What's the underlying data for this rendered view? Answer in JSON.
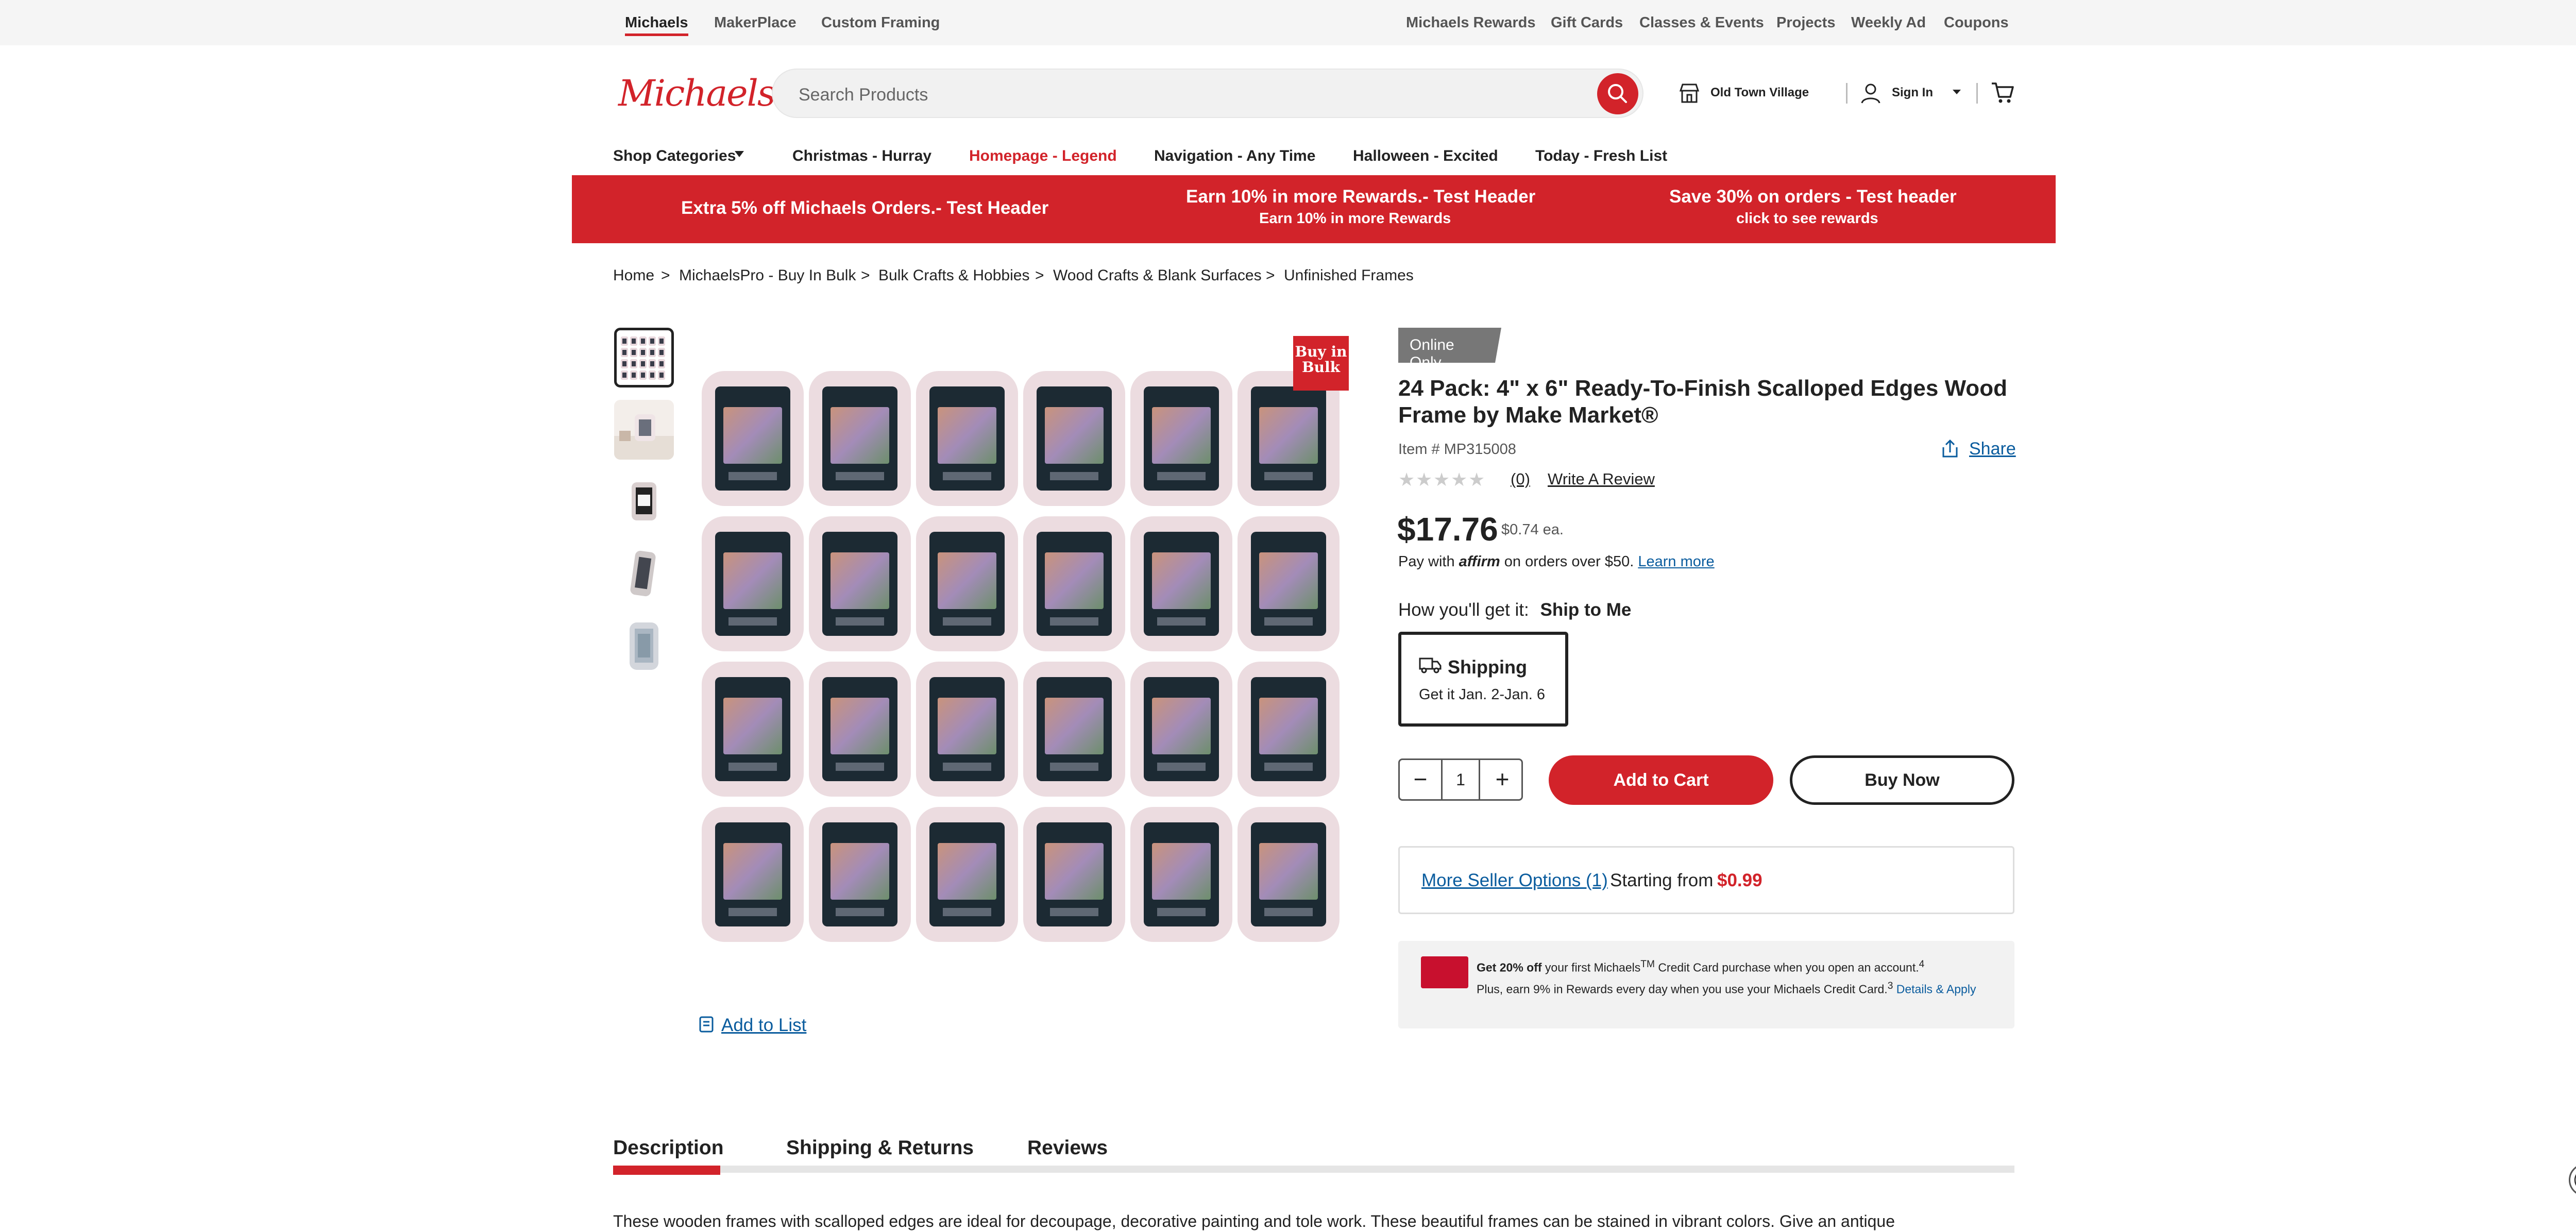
{
  "utility_nav": {
    "left": [
      "Michaels",
      "MakerPlace",
      "Custom Framing"
    ],
    "right": [
      "Michaels Rewards",
      "Gift Cards",
      "Classes & Events",
      "Projects",
      "Weekly Ad",
      "Coupons"
    ]
  },
  "header": {
    "logo": "Michaels",
    "search_placeholder": "Search Products",
    "store": "Old Town Village",
    "sign_in": "Sign In"
  },
  "main_nav": [
    "Shop Categories",
    "Christmas - Hurray",
    "Homepage - Legend",
    "Navigation - Any Time",
    "Halloween - Excited",
    "Today - Fresh List"
  ],
  "promo": [
    {
      "title": "Extra 5% off Michaels Orders.- Test Header",
      "sub": ""
    },
    {
      "title": "Earn 10% in more Rewards.- Test Header",
      "sub": "Earn 10% in more Rewards"
    },
    {
      "title": "Save 30% on orders - Test header",
      "sub": "click to see rewards"
    }
  ],
  "breadcrumb": [
    "Home",
    "MichaelsPro - Buy In Bulk",
    "Bulk Crafts & Hobbies",
    "Wood Crafts & Blank Surfaces",
    "Unfinished Frames"
  ],
  "badge_bulk": "Buy in Bulk",
  "product": {
    "badge": "Online Only",
    "title": "24 Pack: 4\" x 6\" Ready-To-Finish Scalloped Edges Wood Frame by Make Market®",
    "item_number": "Item # MP315008",
    "share": "Share",
    "rating": 0,
    "review_count": "(0)",
    "write_review": "Write A Review",
    "price": "$17.76",
    "price_each": "$0.74 ea.",
    "affirm_prefix": "Pay with",
    "affirm_brand": "affirm",
    "affirm_suffix": "on orders over $50.",
    "affirm_link": "Learn more",
    "fulfillment_label": "How you'll get it:",
    "fulfillment_value": "Ship to Me",
    "shipping_title": "Shipping",
    "shipping_date": "Get it Jan. 2-Jan. 6",
    "quantity": "1",
    "add_to_cart": "Add to Cart",
    "buy_now": "Buy Now",
    "seller_link": "More Seller Options (1)",
    "seller_text": "Starting from",
    "seller_price": "$0.99",
    "credit_bold": "Get 20% off",
    "credit_text1": "your first Michaels",
    "credit_tm": "TM",
    "credit_text2": "Credit Card purchase when you open an account.",
    "credit_sup1": "4",
    "credit_text3": "Plus, earn 9% in Rewards every day when you use your Michaels Credit Card.",
    "credit_sup2": "3",
    "credit_link": "Details & Apply",
    "add_to_list": "Add to List"
  },
  "tabs": [
    "Description",
    "Shipping & Returns",
    "Reviews"
  ],
  "description": "These wooden frames with scalloped edges are ideal for decoupage, decorative painting and tole work. These beautiful frames can be stained in vibrant colors. Give an antique",
  "colors": {
    "brand_red": "#d2232a",
    "link_blue": "#0a5c9e"
  }
}
